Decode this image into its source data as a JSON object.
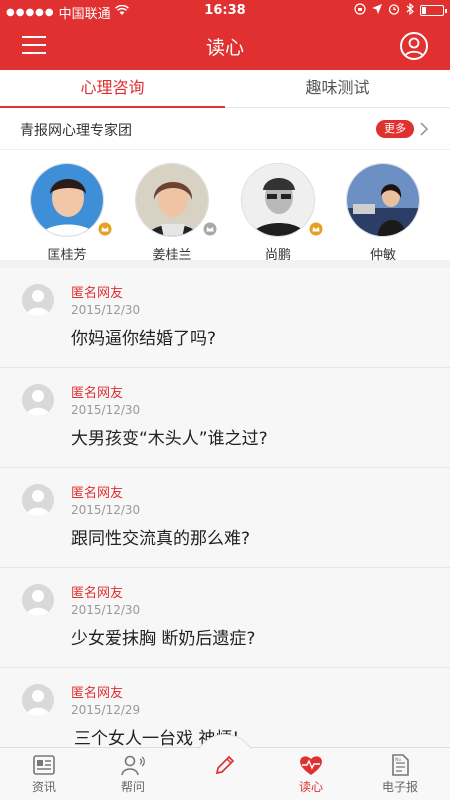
{
  "status": {
    "carrier": "中国联通",
    "time": "16:38"
  },
  "nav": {
    "title": "读心"
  },
  "tabs": [
    {
      "label": "心理咨询",
      "active": true
    },
    {
      "label": "趣味测试",
      "active": false
    }
  ],
  "experts_header": {
    "label": "青报网心理专家团",
    "more": "更多"
  },
  "experts": [
    {
      "name": "匡桂芳",
      "badge": "gold"
    },
    {
      "name": "姜桂兰",
      "badge": "silver"
    },
    {
      "name": "尚鹏",
      "badge": "gold"
    },
    {
      "name": "仲敏",
      "badge": "none"
    }
  ],
  "questions": [
    {
      "nick": "匿名网友",
      "date": "2015/12/30",
      "text": "你妈逼你结婚了吗?"
    },
    {
      "nick": "匿名网友",
      "date": "2015/12/30",
      "text": "大男孩变“木头人”谁之过?"
    },
    {
      "nick": "匿名网友",
      "date": "2015/12/30",
      "text": "跟同性交流真的那么难?"
    },
    {
      "nick": "匿名网友",
      "date": "2015/12/30",
      "text": "少女爱抹胸 断奶后遗症?"
    },
    {
      "nick": "匿名网友",
      "date": "2015/12/29",
      "text": "三个女人一台戏 神烦!"
    }
  ],
  "bottom_tabs": [
    {
      "label": "资讯",
      "icon": "news-icon",
      "active": false
    },
    {
      "label": "帮问",
      "icon": "person-ask-icon",
      "active": false
    },
    {
      "label": "",
      "icon": "pencil-icon",
      "active": false
    },
    {
      "label": "读心",
      "icon": "heart-pulse-icon",
      "active": true
    },
    {
      "label": "电子报",
      "icon": "newspaper-icon",
      "active": false
    }
  ],
  "colors": {
    "accent": "#e03030",
    "gold_badge": "#e8a020",
    "silver_badge": "#a8a8a8"
  }
}
